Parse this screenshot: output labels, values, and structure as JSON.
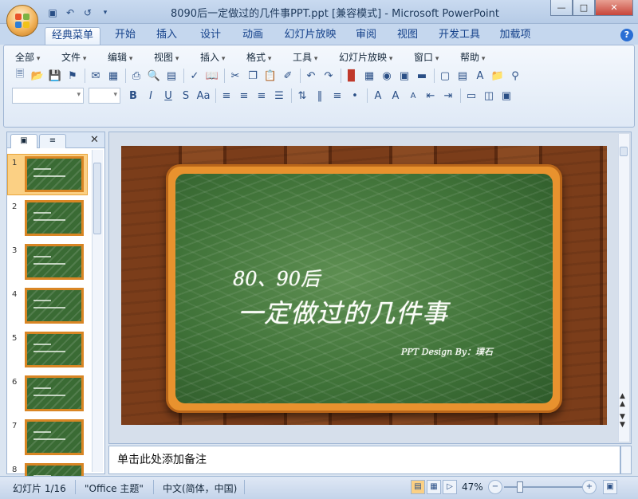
{
  "window": {
    "title": "8090后一定做过的几件事PPT.ppt [兼容模式] - Microsoft PowerPoint",
    "minimize_icon": "minimize-icon",
    "maximize_icon": "maximize-icon",
    "close_icon": "close-icon"
  },
  "ribbon_tabs": [
    "经典菜单",
    "开始",
    "插入",
    "设计",
    "动画",
    "幻灯片放映",
    "审阅",
    "视图",
    "开发工具",
    "加载项"
  ],
  "active_tab": "经典菜单",
  "classic_menu": [
    "全部",
    "文件",
    "编辑",
    "视图",
    "插入",
    "格式",
    "工具",
    "幻灯片放映",
    "窗口",
    "帮助"
  ],
  "slides_pane": {
    "thumb_numbers": [
      "1",
      "2",
      "3",
      "4",
      "5",
      "6",
      "7",
      "8"
    ],
    "selected": "1"
  },
  "slide": {
    "line1": "80、90后",
    "line2": "一定做过的几件事",
    "credit": "PPT Design By：璞石",
    "colors": {
      "board": "#3f7238",
      "frame": "#e8922e",
      "wood": "#7b3d1a"
    }
  },
  "notes": {
    "placeholder": "单击此处添加备注"
  },
  "status": {
    "slide_counter": "幻灯片 1/16",
    "theme": "\"Office 主题\"",
    "language": "中文(简体，中国)",
    "zoom": "47%"
  }
}
